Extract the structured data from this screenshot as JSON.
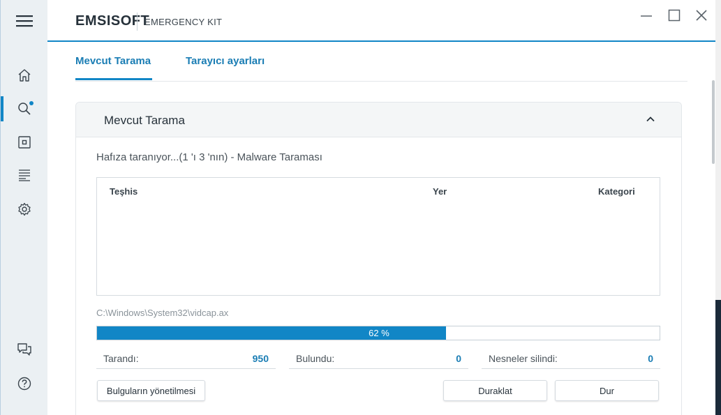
{
  "brand": {
    "name": "EMSISOFT",
    "product": "EMERGENCY KIT"
  },
  "window": {
    "minimize_label": "Minimize",
    "maximize_label": "Maximize",
    "close_label": "Close"
  },
  "sidebar": {
    "items": [
      {
        "icon": "home-icon"
      },
      {
        "icon": "scan-icon",
        "active": true
      },
      {
        "icon": "quarantine-icon"
      },
      {
        "icon": "logs-icon"
      },
      {
        "icon": "settings-icon"
      },
      {
        "icon": "feedback-icon"
      },
      {
        "icon": "help-icon"
      }
    ]
  },
  "tabs": [
    {
      "label": "Mevcut Tarama",
      "active": true
    },
    {
      "label": "Tarayıcı ayarları",
      "active": false
    }
  ],
  "panel": {
    "title": "Mevcut Tarama",
    "status": "Hafıza taranıyor...(1 'ı 3 'nın) - Malware Taraması",
    "columns": [
      "Teşhis",
      "Yer",
      "Kategori"
    ],
    "current_file": "C:\\Windows\\System32\\vidcap.ax",
    "progress": {
      "value": 0.62,
      "label": "62 %"
    },
    "stats": [
      {
        "label": "Tarandı:",
        "value": "950"
      },
      {
        "label": "Bulundu:",
        "value": "0"
      },
      {
        "label": "Nesneler silindi:",
        "value": "0"
      }
    ],
    "buttons": {
      "manage": "Bulguların yönetilmesi",
      "pause": "Duraklat",
      "stop": "Dur"
    }
  },
  "colors": {
    "accent": "#1186c6",
    "sidebar_bg": "#ebf0f3",
    "text": "#26313a"
  }
}
